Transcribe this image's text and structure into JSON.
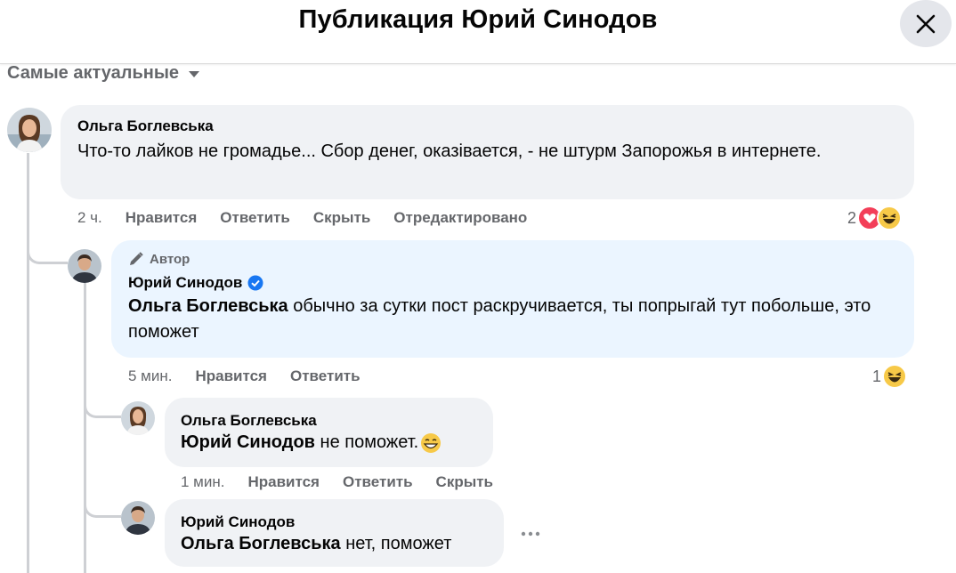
{
  "header": {
    "title": "Публикация Юрий Синодов"
  },
  "sort": {
    "label": "Самые актуальные"
  },
  "comments": [
    {
      "author": "Ольга Боглевська",
      "text": "Что-то лайков не громадье... Сбор денег, оказівается, - не штурм Запорожья в интернете.",
      "actions": {
        "time": "2 ч.",
        "like": "Нравится",
        "reply": "Ответить",
        "hide": "Скрыть",
        "edited": "Отредактировано"
      },
      "reactions_count": "2"
    },
    {
      "author_badge": "Автор",
      "author": "Юрий Синодов",
      "mention": "Ольга Боглевська",
      "text": "обычно за сутки пост раскручивается, ты попрыгай тут побольше, это поможет",
      "actions": {
        "time": "5 мин.",
        "like": "Нравится",
        "reply": "Ответить"
      },
      "reactions_count": "1"
    },
    {
      "author": "Ольга Боглевська",
      "mention": "Юрий Синодов",
      "text": "не поможет.",
      "actions": {
        "time": "1 мин.",
        "like": "Нравится",
        "reply": "Ответить",
        "hide": "Скрыть"
      }
    },
    {
      "author": "Юрий Синодов",
      "mention": "Ольга Боглевська",
      "text": "нет, поможет"
    }
  ],
  "colors": {
    "bubble": "#f0f2f5",
    "author_bubble": "#ebf5ff",
    "verified": "#1877f2",
    "muted": "#65676b"
  }
}
